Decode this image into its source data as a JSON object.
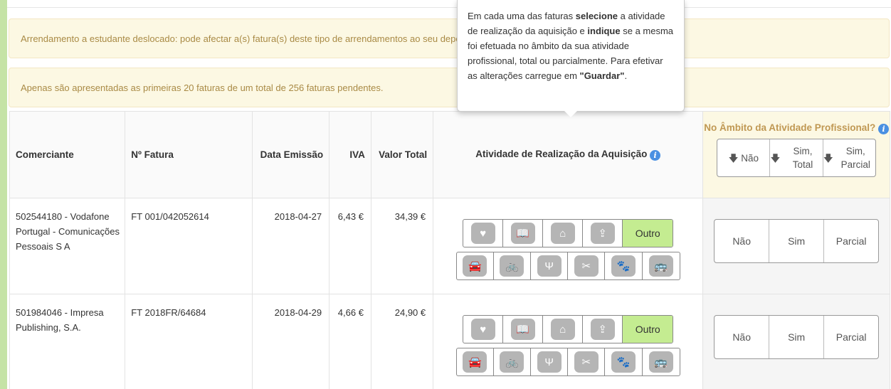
{
  "alerts": {
    "student_rent": "Arrendamento a estudante deslocado: pode afectar a(s) fatura(s) deste tipo de arrendamentos ao seu dependente",
    "pagination": "Apenas são apresentadas as primeiras 20 faturas de um total de 256 faturas pendentes."
  },
  "tooltip": {
    "p1": "Em cada uma das faturas ",
    "b1": "selecione",
    "p2": " a atividade de realização da aquisição e ",
    "b2": "indique",
    "p3": " se a mesma foi efetuada no âmbito da sua atividade profissional, total ou parcialmente. Para efetivar as alterações carregue em ",
    "b3": "\"Guardar\"",
    "p4": "."
  },
  "table": {
    "headers": {
      "comerciante": "Comerciante",
      "fatura": "Nº Fatura",
      "data": "Data Emissão",
      "iva": "IVA",
      "valor": "Valor Total",
      "atividade": "Atividade de Realização da Aquisição",
      "ambito": "No Âmbito da Atividade Profissional?",
      "ambito_nao": "Não",
      "ambito_sim_total": "Sim, Total",
      "ambito_sim_parcial": "Sim, Parcial"
    },
    "rows": [
      {
        "comerciante": "502544180 - Vodafone Portugal - Comunicações Pessoais S A",
        "fatura": "FT 001/042052614",
        "data": "2018-04-27",
        "iva": "6,43 €",
        "valor": "34,39 €",
        "outro": "Outro",
        "nao": "Não",
        "sim": "Sim",
        "parcial": "Parcial"
      },
      {
        "comerciante": "501984046 - Impresa Publishing, S.A.",
        "fatura": "FT 2018FR/64684",
        "data": "2018-04-29",
        "iva": "4,66 €",
        "valor": "24,90 €",
        "outro": "Outro",
        "nao": "Não",
        "sim": "Sim",
        "parcial": "Parcial"
      }
    ]
  },
  "icons": {
    "row1": [
      "heart-pulse-icon",
      "book-icon",
      "house-icon",
      "home-person-icon"
    ],
    "row2": [
      "car-icon",
      "bicycle-icon",
      "fork-knife-icon",
      "scissors-comb-icon",
      "paw-icon",
      "bus-icon"
    ]
  },
  "colors": {
    "alert_bg": "#fcf8e3",
    "alert_text": "#a98a45",
    "outro_selected": "#c4ec91",
    "icon_grey": "#b5b5b5",
    "info_blue": "#4a90e2",
    "side_green": "#c5e3a6"
  }
}
